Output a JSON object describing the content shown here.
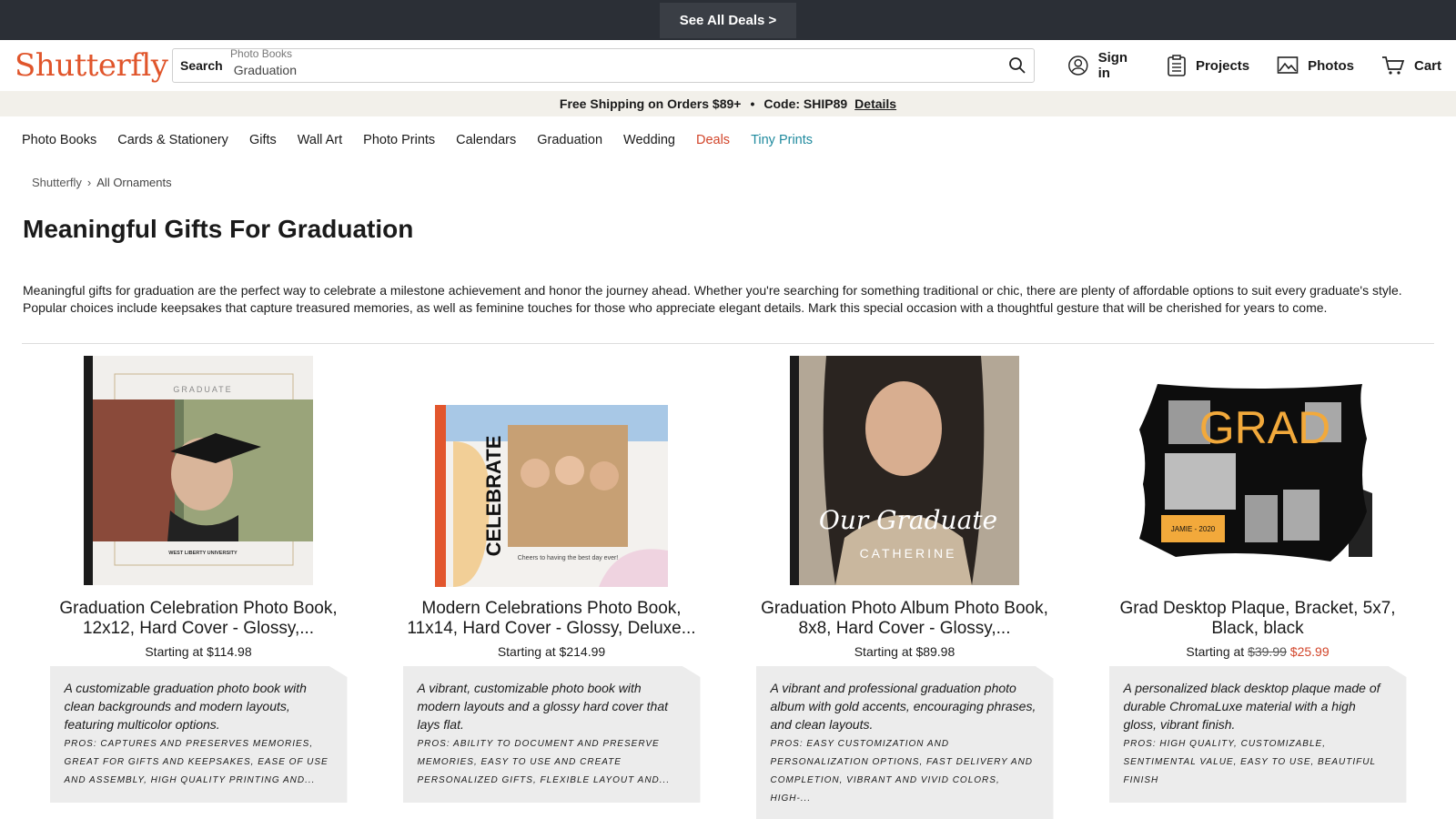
{
  "topbar": {
    "deals_label": "See All Deals >"
  },
  "header": {
    "logo": "Shutterfly",
    "search_label": "Search",
    "search_ghost": "Photo Books",
    "search_value": "Graduation",
    "nav": [
      {
        "label": "Sign in",
        "icon": "user-circle-icon"
      },
      {
        "label": "Projects",
        "icon": "clipboard-icon"
      },
      {
        "label": "Photos",
        "icon": "image-icon"
      },
      {
        "label": "Cart",
        "icon": "cart-icon"
      }
    ]
  },
  "promo": {
    "text": "Free Shipping on Orders $89+",
    "code": "Code: SHIP89",
    "link": "Details"
  },
  "categories": [
    "Photo Books",
    "Cards & Stationery",
    "Gifts",
    "Wall Art",
    "Photo Prints",
    "Calendars",
    "Graduation",
    "Wedding",
    "Deals",
    "Tiny Prints"
  ],
  "breadcrumb": {
    "root": "Shutterfly",
    "current": "All Ornaments"
  },
  "page": {
    "title": "Meaningful Gifts For Graduation",
    "description": "Meaningful gifts for graduation are the perfect way to celebrate a milestone achievement and honor the journey ahead. Whether you're searching for something traditional or chic, there are plenty of affordable options to suit every graduate's style. Popular choices include keepsakes that capture treasured memories, as well as feminine touches for those who appreciate elegant details. Mark this special occasion with a thoughtful gesture that will be cherished for years to come."
  },
  "products": [
    {
      "name": "Graduation Celebration Photo Book, 12x12, Hard Cover - Glossy,...",
      "price_prefix": "Starting at",
      "price": "$114.98",
      "old_price": "",
      "summary": "A customizable graduation photo book with clean backgrounds and modern layouts, featuring multicolor options.",
      "pros": "Pros: Captures and preserves memories, great for gifts and keepsakes, ease of use and assembly, high quality printing and...",
      "cover_text": "GRADUATE",
      "cover_sub": "WEST LIBERTY UNIVERSITY"
    },
    {
      "name": "Modern Celebrations Photo Book, 11x14, Hard Cover - Glossy, Deluxe...",
      "price_prefix": "Starting at",
      "price": "$214.99",
      "old_price": "",
      "summary": "A vibrant, customizable photo book with modern layouts and a glossy hard cover that lays flat.",
      "pros": "Pros: Ability to document and preserve memories, easy to use and create personalized gifts, flexible layout and...",
      "cover_text": "CELEBRATE",
      "cover_sub": "Cheers to having the best day ever!"
    },
    {
      "name": "Graduation Photo Album Photo Book, 8x8, Hard Cover - Glossy,...",
      "price_prefix": "Starting at",
      "price": "$89.98",
      "old_price": "",
      "summary": "A vibrant and professional graduation photo album with gold accents, encouraging phrases, and clean layouts.",
      "pros": "Pros: Easy customization and personalization options, fast delivery and completion, vibrant and vivid colors, high-...",
      "cover_text": "Our Graduate",
      "cover_sub": "CATHERINE"
    },
    {
      "name": "Grad Desktop Plaque, Bracket, 5x7, Black, black",
      "price_prefix": "Starting at",
      "price": "$25.99",
      "old_price": "$39.99",
      "summary": "A personalized black desktop plaque made of durable ChromaLuxe material with a high gloss, vibrant finish.",
      "pros": "Pros: High quality, customizable, sentimental value, easy to use, beautiful finish",
      "cover_text": "GRAD",
      "cover_sub": "JAMIE - 2020"
    }
  ],
  "colors": {
    "accent": "#e0552b",
    "deals": "#d2452a",
    "tiny_prints": "#1f8a9e",
    "topbar": "#2b2f36",
    "promo_bg": "#f2f0ea"
  }
}
